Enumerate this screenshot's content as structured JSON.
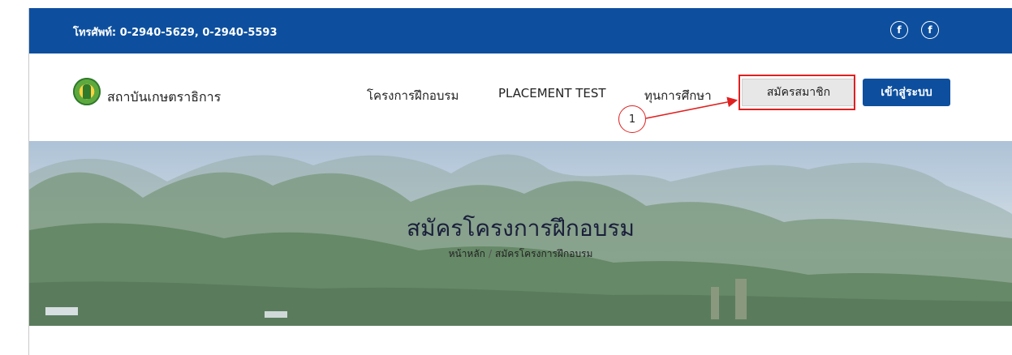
{
  "topbar": {
    "phone": "โทรศัพท์: 0-2940-5629, 0-2940-5593",
    "social": [
      {
        "icon": "facebook-icon",
        "glyph": "f"
      },
      {
        "icon": "facebook-icon",
        "glyph": "f"
      }
    ]
  },
  "header": {
    "brand": "สถาบันเกษตราธิการ",
    "nav": [
      {
        "label": "โครงการฝึกอบรม"
      },
      {
        "label": "PLACEMENT TEST"
      },
      {
        "label": "ทุนการศึกษา"
      }
    ],
    "register_label": "สมัครสมาชิก",
    "login_label": "เข้าสู่ระบบ",
    "callout_number": "1"
  },
  "hero": {
    "title": "สมัครโครงการฝึกอบรม",
    "breadcrumb_home": "หน้าหลัก",
    "breadcrumb_separator": "/",
    "breadcrumb_current": "สมัครโครงการฝึกอบรม"
  },
  "colors": {
    "brand_blue": "#0d4f9e",
    "annotation_red": "#e02020"
  }
}
